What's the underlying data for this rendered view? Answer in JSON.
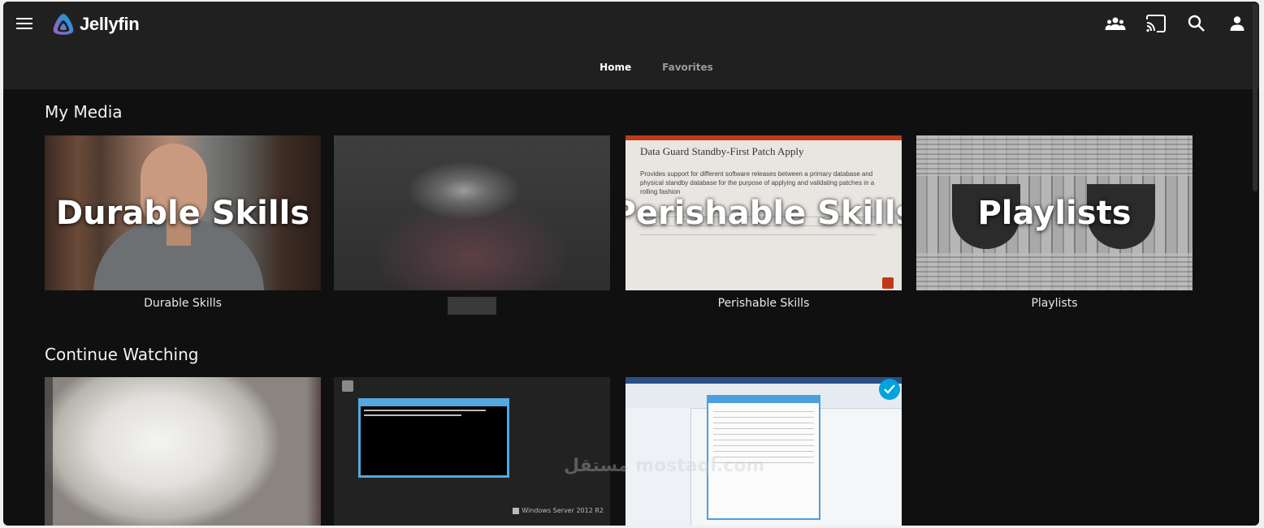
{
  "header": {
    "logo_text": "Jellyfin",
    "icons": [
      "menu-icon",
      "users-icon",
      "cast-icon",
      "search-icon",
      "user-icon"
    ]
  },
  "tabs": [
    {
      "label": "Home",
      "active": true
    },
    {
      "label": "Favorites",
      "active": false
    }
  ],
  "my_media": {
    "title": "My Media",
    "items": [
      {
        "overlay": "Durable Skills",
        "label": "Durable Skills"
      },
      {
        "overlay": "",
        "label": ""
      },
      {
        "overlay": "Perishable Skills",
        "label": "Perishable Skills"
      },
      {
        "overlay": "Playlists",
        "label": "Playlists"
      }
    ],
    "slide_title": "Data Guard Standby-First Patch Apply",
    "slide_text": "Provides support for different software releases between a primary database and physical standby database for the purpose of applying and validating patches in a rolling fashion"
  },
  "continue_watching": {
    "title": "Continue Watching",
    "windows_label": "Windows Server 2012 R2"
  },
  "watermark": "مستقل mostaql.com",
  "colors": {
    "background": "#101010",
    "header": "#202020",
    "accent": "#00a4dc"
  }
}
